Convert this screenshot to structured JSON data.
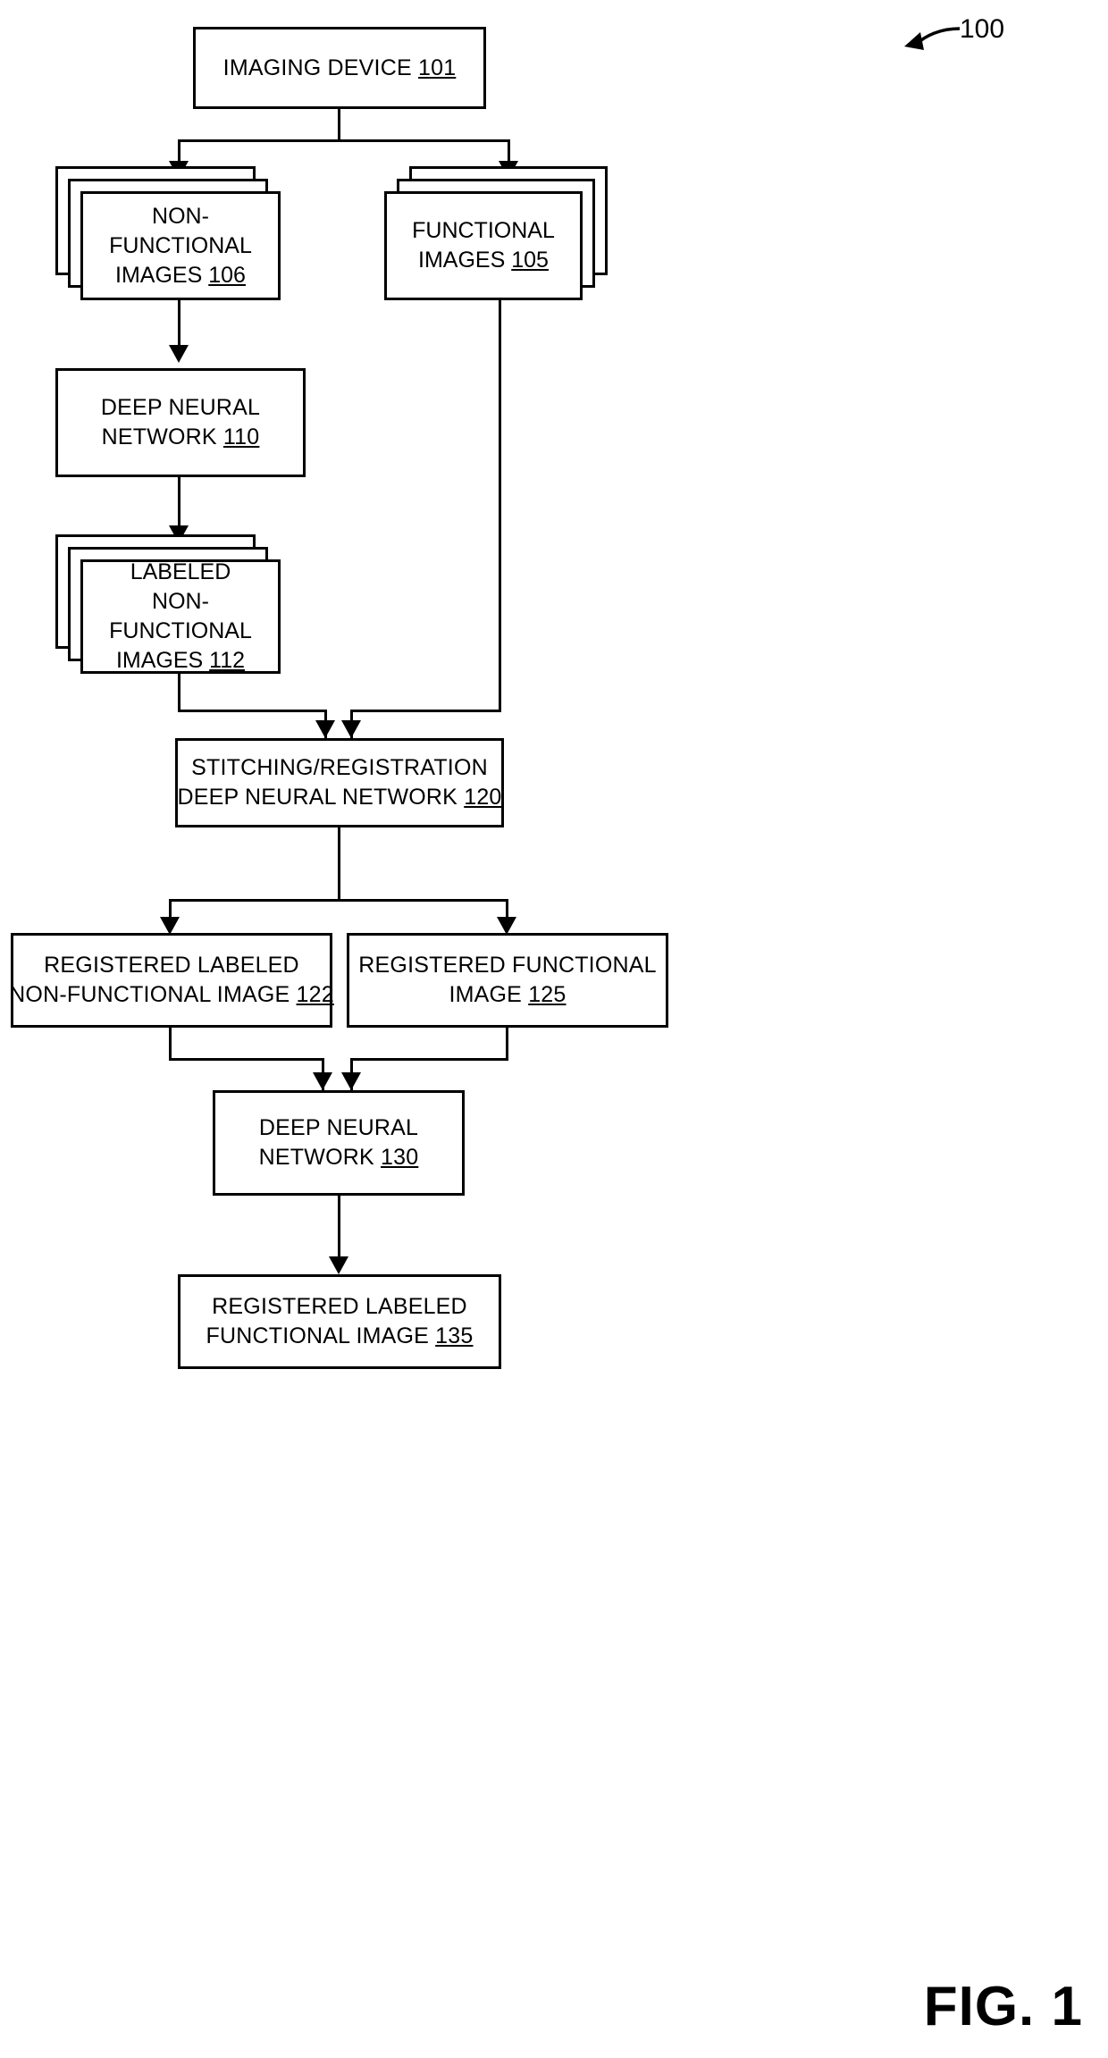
{
  "figure": {
    "label": "FIG. 1",
    "callout_number": "100"
  },
  "nodes": {
    "imaging_device": {
      "line1": "IMAGING DEVICE",
      "ref": "101"
    },
    "non_functional_images": {
      "line1": "NON-FUNCTIONAL",
      "line2": "IMAGES",
      "ref": "106"
    },
    "functional_images": {
      "line1": "FUNCTIONAL",
      "line2": "IMAGES",
      "ref": "105"
    },
    "deep_neural_network_110": {
      "line1": "DEEP NEURAL",
      "line2": "NETWORK",
      "ref": "110"
    },
    "labeled_non_functional_images": {
      "line1": "LABELED",
      "line2": "NON-FUNCTIONAL",
      "line3": "IMAGES",
      "ref": "112"
    },
    "stitching_registration_dnn": {
      "line1": "STITCHING/REGISTRATION",
      "line2": "DEEP NEURAL NETWORK",
      "ref": "120"
    },
    "registered_labeled_non_functional_image": {
      "line1": "REGISTERED LABELED",
      "line2": "NON-FUNCTIONAL IMAGE",
      "ref": "122"
    },
    "registered_functional_image": {
      "line1": "REGISTERED FUNCTIONAL",
      "line2": "IMAGE",
      "ref": "125"
    },
    "deep_neural_network_130": {
      "line1": "DEEP NEURAL",
      "line2": "NETWORK",
      "ref": "130"
    },
    "registered_labeled_functional_image": {
      "line1": "REGISTERED LABELED",
      "line2": "FUNCTIONAL IMAGE",
      "ref": "135"
    }
  },
  "colors": {
    "ink": "#000000",
    "paper": "#ffffff"
  }
}
